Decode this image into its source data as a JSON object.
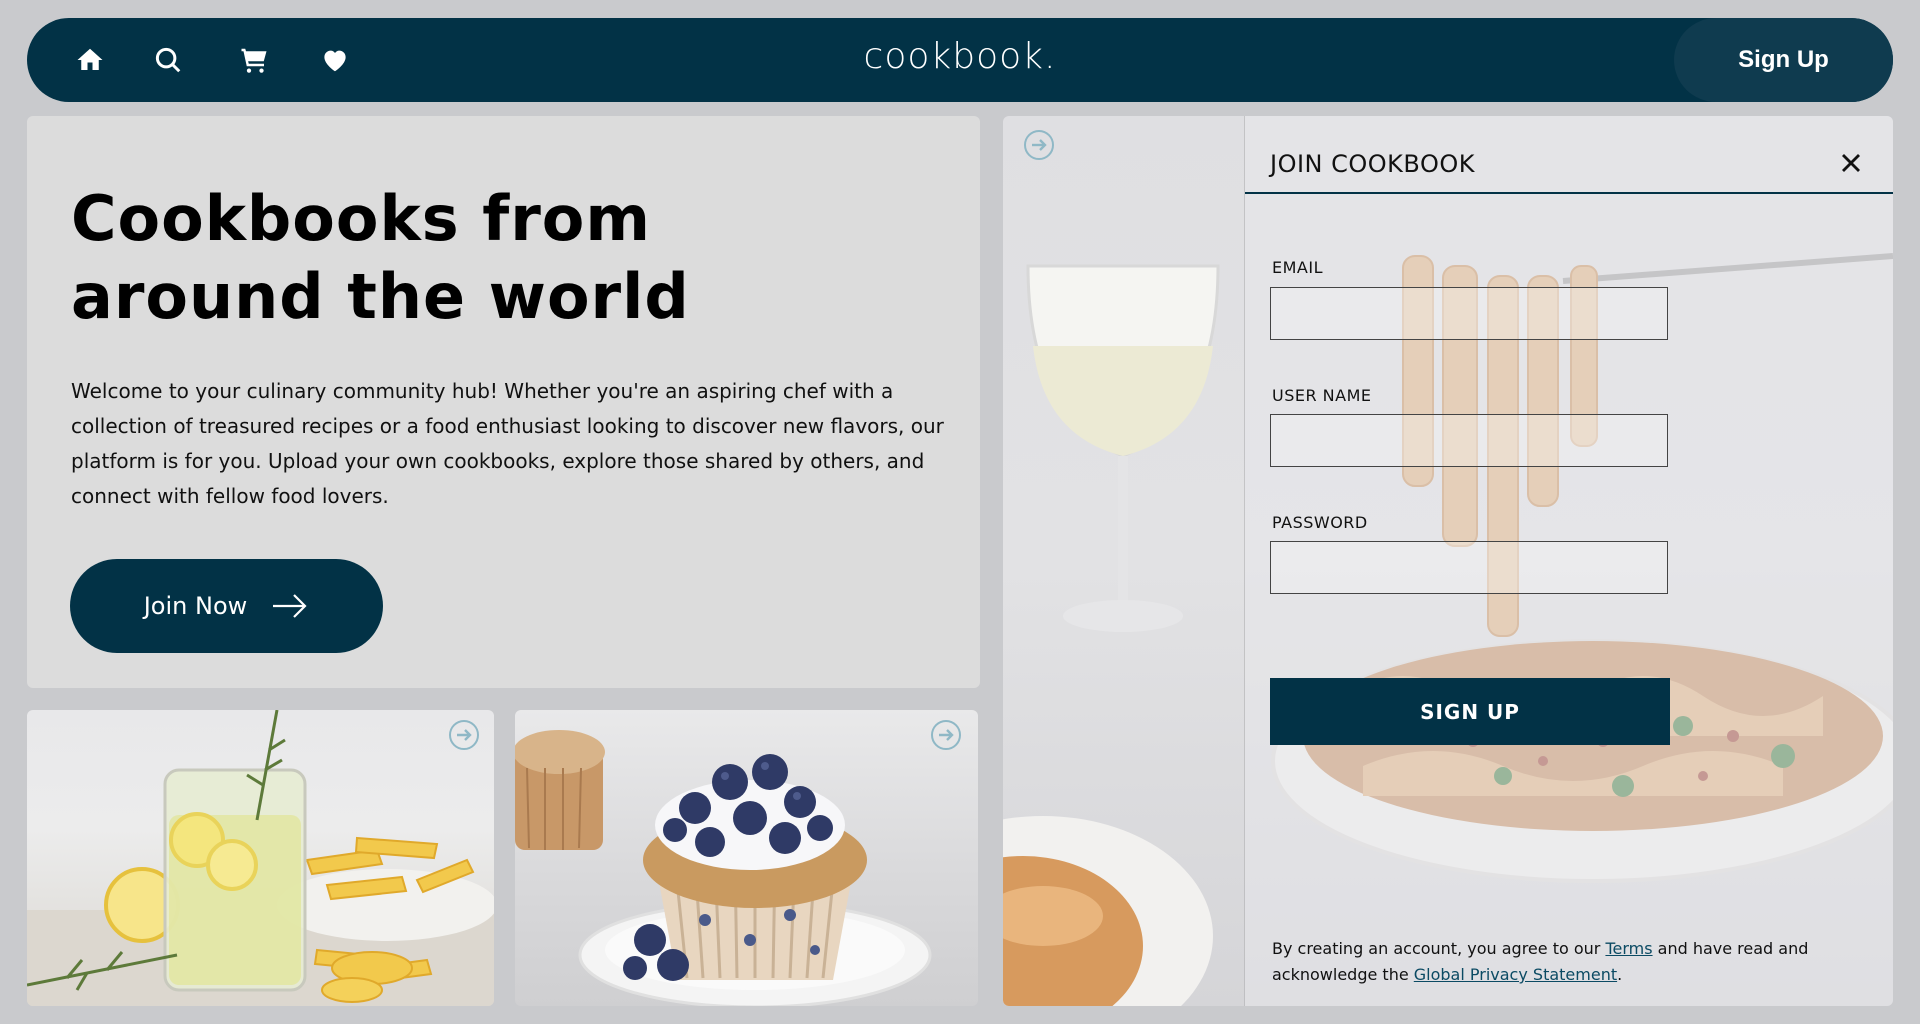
{
  "nav": {
    "brand": "cookbook.",
    "signup_label": "Sign Up",
    "icons": [
      "home-icon",
      "search-icon",
      "cart-icon",
      "heart-icon"
    ],
    "bg_color": "#023246"
  },
  "hero": {
    "title_line1": "Cookbooks from",
    "title_line2": "around the world",
    "text": "Welcome to your culinary community hub! Whether you're an aspiring chef with a collection of treasured recipes or a food enthusiast looking to discover new flavors, our platform is for you. Upload your own cookbooks, explore those shared by others, and connect with fellow food lovers.",
    "join_label": "Join Now"
  },
  "cards": [
    {
      "subject": "lemonade with lemon slices and rosemary",
      "icon": "arrow-right-circle-icon"
    },
    {
      "subject": "blueberry muffin with frosting",
      "icon": "arrow-right-circle-icon"
    }
  ],
  "signup_form": {
    "title": "JOIN COOKBOOK",
    "email_label": "EMAIL",
    "email_value": "",
    "username_label": "USER NAME",
    "username_value": "",
    "password_label": "PASSWORD",
    "password_value": "",
    "submit_label": "SIGN UP",
    "legal_prefix": "By creating an account, you agree to our ",
    "terms_link": "Terms",
    "legal_middle": " and have read and acknowledge the ",
    "privacy_link": "Global Privacy Statement",
    "legal_suffix": "."
  },
  "colors": {
    "accent": "#023246",
    "arrow_circle": "#8fb8c6",
    "page_bg": "#c9cacd"
  }
}
